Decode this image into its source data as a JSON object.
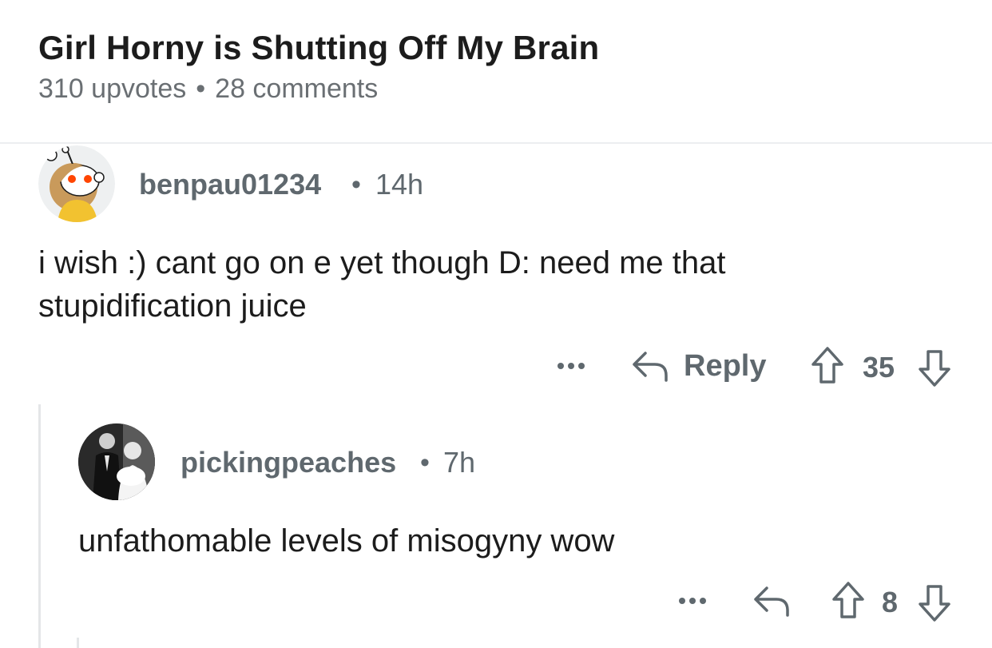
{
  "post": {
    "title": "Girl Horny is Shutting Off My Brain",
    "upvotes": "310 upvotes",
    "separator": "•",
    "comments": "28 comments"
  },
  "comments": [
    {
      "username": "benpau01234",
      "separator": "•",
      "time": "14h",
      "body_line1": "i wish :) cant go on e yet though D: need me that",
      "body_line2": "stupidification juice",
      "reply_label": "Reply",
      "score": "35",
      "avatar_icon": "snoo-avatar-icon"
    },
    {
      "username": "pickingpeaches",
      "separator": "•",
      "time": "7h",
      "body": "unfathomable levels of misogyny wow",
      "score": "8",
      "avatar_icon": "photo-avatar-icon"
    }
  ],
  "colors": {
    "text_primary": "#1c1c1c",
    "text_secondary": "#5f686e",
    "divider": "#eceef0"
  }
}
